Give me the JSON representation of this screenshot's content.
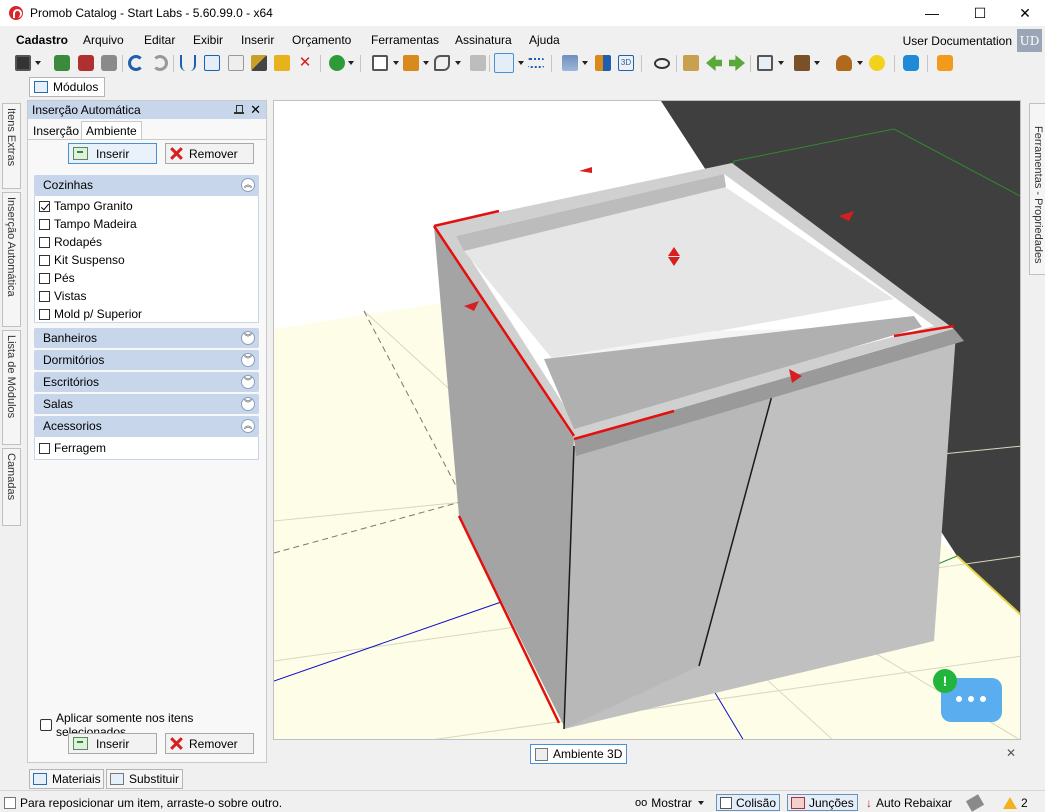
{
  "window": {
    "title": "Promob Catalog - Start Labs - 5.60.99.0 - x64",
    "minimize": "—",
    "maximize": "☐",
    "close": "✕"
  },
  "menu": {
    "items": [
      "Cadastro",
      "Arquivo",
      "Editar",
      "Exibir",
      "Inserir",
      "Orçamento",
      "Ferramentas",
      "Assinatura",
      "Ajuda"
    ],
    "user_doc": "User Documentation",
    "user_badge": "UD"
  },
  "tabs": {
    "modulos": "Módulos",
    "materiais": "Materiais",
    "substituir": "Substituir",
    "ambiente3d": "Ambiente 3D"
  },
  "left_side_tabs": [
    "Itens Extras",
    "Inserção Automática",
    "Lista de Módulos",
    "Camadas"
  ],
  "right_side_tabs": [
    "Ferramentas - Propriedades"
  ],
  "panel": {
    "title": "Inserção Automática",
    "close": "✕",
    "tabs": [
      "Inserção",
      "Ambiente"
    ],
    "insert_label": "Inserir",
    "remove_label": "Remover",
    "groups": [
      {
        "name": "Cozinhas",
        "expanded": true,
        "items": [
          {
            "label": "Tampo Granito",
            "checked": true
          },
          {
            "label": "Tampo Madeira",
            "checked": false
          },
          {
            "label": "Rodapés",
            "checked": false
          },
          {
            "label": "Kit Suspenso",
            "checked": false
          },
          {
            "label": "Pés",
            "checked": false
          },
          {
            "label": "Vistas",
            "checked": false
          },
          {
            "label": "Mold p/ Superior",
            "checked": false
          }
        ]
      },
      {
        "name": "Banheiros",
        "expanded": false
      },
      {
        "name": "Dormitórios",
        "expanded": false
      },
      {
        "name": "Escritórios",
        "expanded": false
      },
      {
        "name": "Salas",
        "expanded": false
      },
      {
        "name": "Acessorios",
        "expanded": true,
        "items": [
          {
            "label": "Ferragem",
            "checked": false
          }
        ]
      }
    ],
    "apply_selected": "Aplicar somente nos itens selecionados"
  },
  "chat": {
    "badge": "!"
  },
  "status": {
    "message": "Para reposicionar um item, arraste-o sobre outro.",
    "mostrar": "Mostrar",
    "colisao": "Colisão",
    "juncoes": "Junções",
    "auto_rebaixar": "Auto Rebaixar",
    "count": "2"
  },
  "colors": {
    "accent": "#4a90d6",
    "panel_header": "#c7d6ea",
    "floor": "#fefee8",
    "wall_dark": "#3f3f3f",
    "cabinet_side": "#a4a4a4",
    "cabinet_front": "#c0c0c0",
    "edge_highlight": "#e31010",
    "bounding_box": "#2e8b2e"
  }
}
